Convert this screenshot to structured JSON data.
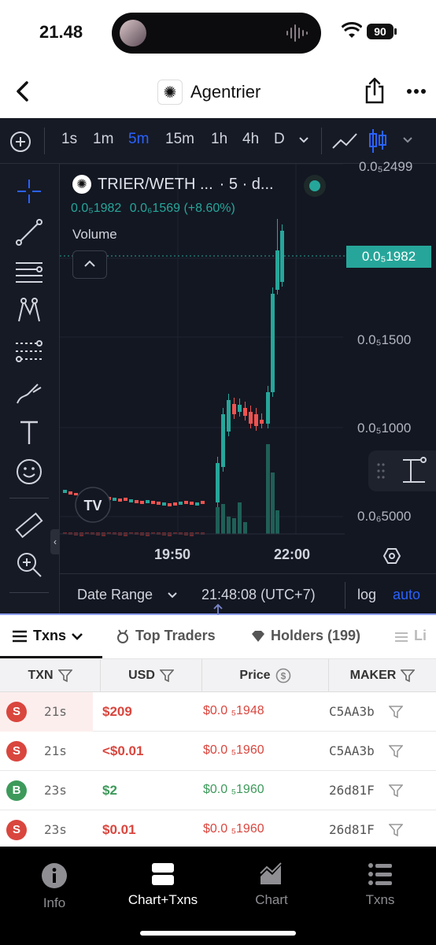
{
  "status_bar": {
    "time": "21.48",
    "battery": "90"
  },
  "nav": {
    "title": "Agentrier"
  },
  "toolbar": {
    "timeframes": [
      "1s",
      "1m",
      "5m",
      "15m",
      "1h",
      "4h",
      "D"
    ],
    "active_timeframe": "5m"
  },
  "chart": {
    "pair": "TRIER/WETH ...",
    "interval": "· 5 · d...",
    "ohlc_close": "0.0₅1982",
    "change": "0.0₆1569 (+8.60%)",
    "volume_label": "Volume",
    "last_price": "0.0₅1982",
    "y_axis_labels": [
      "0.0₅2499",
      "0.0₅1500",
      "0.0₅1000",
      "0.0₆5000"
    ],
    "x_axis_labels": [
      "19:50",
      "22:00"
    ],
    "range_label": "Date Range",
    "clock": "21:48:08 (UTC+7)",
    "log_label": "log",
    "auto_label": "auto",
    "colors": {
      "up": "#26a69a",
      "down": "#ef5350",
      "bg": "#131722"
    }
  },
  "tabs": [
    {
      "label": "Txns"
    },
    {
      "label": "Top Traders"
    },
    {
      "label": "Holders (199)"
    },
    {
      "label": "Li"
    }
  ],
  "table": {
    "headers": [
      "TXN",
      "USD",
      "Price",
      "MAKER"
    ],
    "rows": [
      {
        "type": "S",
        "age": "21s",
        "usd": "$209",
        "price": "$0.0 ₅1948",
        "maker": "C5AA3b"
      },
      {
        "type": "S",
        "age": "21s",
        "usd": "<$0.01",
        "price": "$0.0 ₅1960",
        "maker": "C5AA3b"
      },
      {
        "type": "B",
        "age": "23s",
        "usd": "$2",
        "price": "$0.0 ₅1960",
        "maker": "26d81F"
      },
      {
        "type": "S",
        "age": "23s",
        "usd": "$0.01",
        "price": "$0.0 ₅1960",
        "maker": "26d81F"
      }
    ]
  },
  "bottom_nav": [
    {
      "label": "Info",
      "icon": "info-icon"
    },
    {
      "label": "Chart+Txns",
      "icon": "split-view-icon"
    },
    {
      "label": "Chart",
      "icon": "area-chart-icon"
    },
    {
      "label": "Txns",
      "icon": "list-icon"
    }
  ]
}
